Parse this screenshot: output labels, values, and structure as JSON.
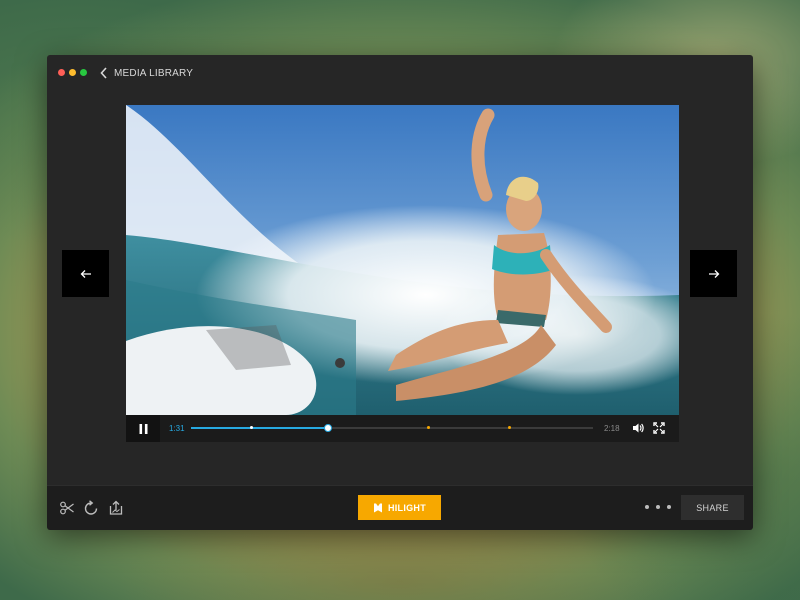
{
  "window": {
    "breadcrumb_label": "MEDIA LIBRARY",
    "traffic_lights": {
      "close": "#ff5f57",
      "minimize": "#febc2e",
      "maximize": "#28c840"
    }
  },
  "player": {
    "current_time": "1:31",
    "total_time": "2:18",
    "progress_fraction": 0.34,
    "hilight_marker_fractions": [
      0.15,
      0.59,
      0.79
    ],
    "accent_color": "#27a9e1",
    "marker_color": "#f7a800",
    "state": "playing",
    "icons": {
      "pause": "pause-icon",
      "volume": "volume-icon",
      "fullscreen": "fullscreen-icon",
      "prev": "arrow-left-icon",
      "next": "arrow-right-icon"
    }
  },
  "toolbar": {
    "hilight_label": "HILIGHT",
    "share_label": "SHARE",
    "hilight_color": "#f7a800",
    "tools": [
      "scissors-icon",
      "rotate-icon",
      "export-icon"
    ],
    "more_icon": "more-dots-icon"
  }
}
